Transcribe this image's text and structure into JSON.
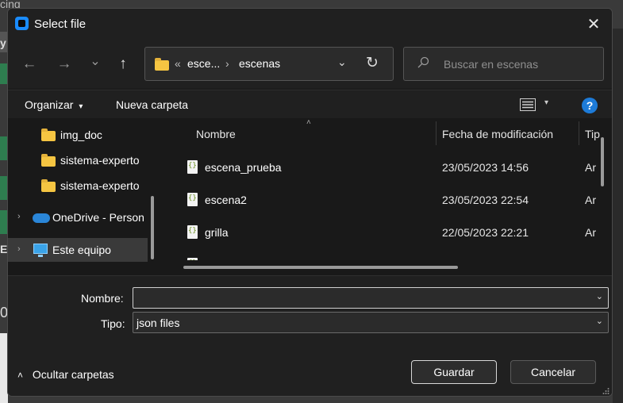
{
  "background": {
    "top_text": "cing",
    "side_text_1": "y",
    "side_text_2": "E",
    "side_text_3": "0"
  },
  "dialog": {
    "title": "Select file",
    "close_glyph": "✕"
  },
  "nav": {
    "back_glyph": "←",
    "forward_glyph": "→",
    "recent_glyph": "⌄",
    "up_glyph": "↑",
    "address": {
      "prefix": "«",
      "crumb1": "esce...",
      "separator": "›",
      "crumb2": "escenas",
      "dropdown_glyph": "⌄",
      "refresh_glyph": "↻"
    },
    "search": {
      "placeholder": "Buscar en escenas"
    }
  },
  "commands": {
    "organize": "Organizar",
    "organize_chev": "▾",
    "new_folder": "Nueva carpeta",
    "view_chev": "▾",
    "help_glyph": "?"
  },
  "sidebar": {
    "items": [
      {
        "label": "img_doc",
        "icon": "folder-icon"
      },
      {
        "label": "sistema-experto",
        "icon": "folder-icon"
      },
      {
        "label": "sistema-experto",
        "icon": "folder-icon"
      },
      {
        "label": "OneDrive - Person",
        "icon": "cloud-icon",
        "expander": "›"
      },
      {
        "label": "Este equipo",
        "icon": "computer-icon",
        "expander": "›",
        "selected": true
      }
    ]
  },
  "files": {
    "columns": {
      "name": "Nombre",
      "date": "Fecha de modificación",
      "type": "Tip"
    },
    "sort_caret": "˄",
    "rows": [
      {
        "name": "escena_prueba",
        "date": "23/05/2023 14:56",
        "type": "Ar"
      },
      {
        "name": "escena2",
        "date": "23/05/2023 22:54",
        "type": "Ar"
      },
      {
        "name": "grilla",
        "date": "22/05/2023 22:21",
        "type": "Ar"
      }
    ]
  },
  "footer": {
    "name_label": "Nombre:",
    "name_value": "",
    "type_label": "Tipo:",
    "type_value": "json files",
    "dropdown_glyph": "⌄",
    "hide_folders": "Ocultar carpetas",
    "hide_folders_glyph": "˄",
    "save": "Guardar",
    "cancel": "Cancelar"
  }
}
